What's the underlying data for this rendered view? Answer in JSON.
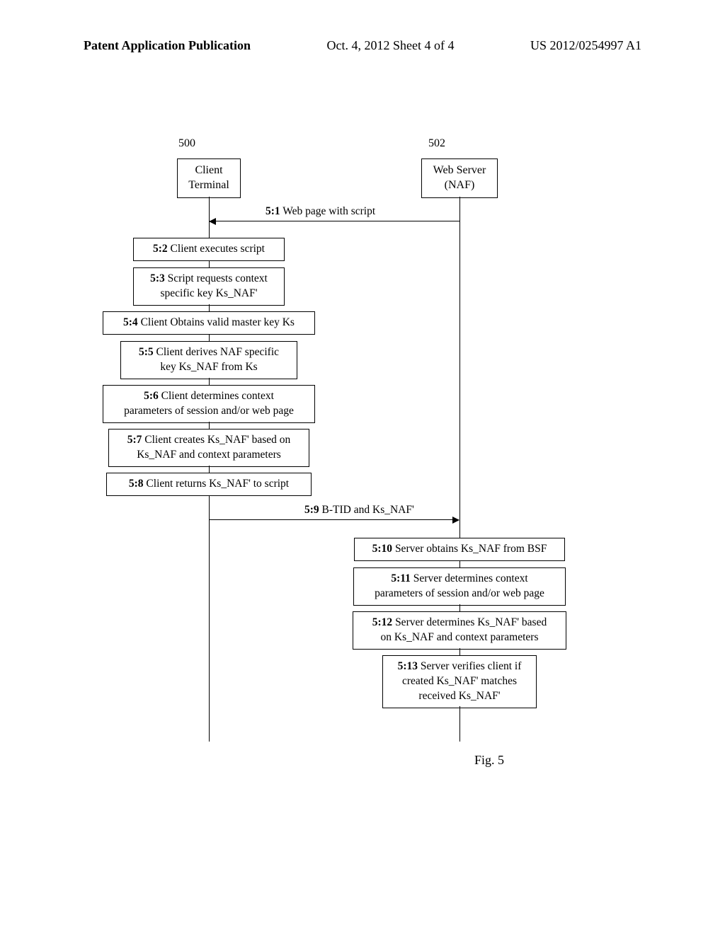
{
  "header": {
    "left": "Patent Application Publication",
    "center": "Oct. 4, 2012  Sheet 4 of 4",
    "right": "US 2012/0254997 A1"
  },
  "participants": {
    "client": {
      "ref": "500",
      "line1": "Client",
      "line2": "Terminal"
    },
    "server": {
      "ref": "502",
      "line1": "Web Server",
      "line2": "(NAF)"
    }
  },
  "messages": {
    "m1": {
      "num": "5:1",
      "text": " Web page with script"
    },
    "m9": {
      "num": "5:9",
      "text": " B-TID and Ks_NAF'"
    }
  },
  "steps": {
    "s2": {
      "num": "5:2",
      "text": " Client executes script"
    },
    "s3": {
      "num": "5:3",
      "text_a": " Script requests context",
      "text_b": "specific key Ks_NAF'"
    },
    "s4": {
      "num": "5:4",
      "text": " Client Obtains valid master key Ks"
    },
    "s5": {
      "num": "5:5",
      "text_a": " Client derives NAF specific",
      "text_b": "key  Ks_NAF from Ks"
    },
    "s6": {
      "num": "5:6",
      "text_a": " Client determines context",
      "text_b": "parameters of session and/or web page"
    },
    "s7": {
      "num": "5:7",
      "text_a": " Client creates Ks_NAF' based on",
      "text_b": "Ks_NAF and context parameters"
    },
    "s8": {
      "num": "5:8",
      "text": " Client returns Ks_NAF' to script"
    },
    "s10": {
      "num": "5:10",
      "text": " Server obtains Ks_NAF from BSF"
    },
    "s11": {
      "num": "5:11",
      "text_a": " Server determines context",
      "text_b": "parameters of session and/or web page"
    },
    "s12": {
      "num": "5:12",
      "text_a": " Server determines Ks_NAF' based",
      "text_b": "on Ks_NAF and context parameters"
    },
    "s13": {
      "num": "5:13",
      "text_a": " Server verifies client if",
      "text_b": "created Ks_NAF' matches",
      "text_c": "received Ks_NAF'"
    }
  },
  "caption": "Fig. 5"
}
